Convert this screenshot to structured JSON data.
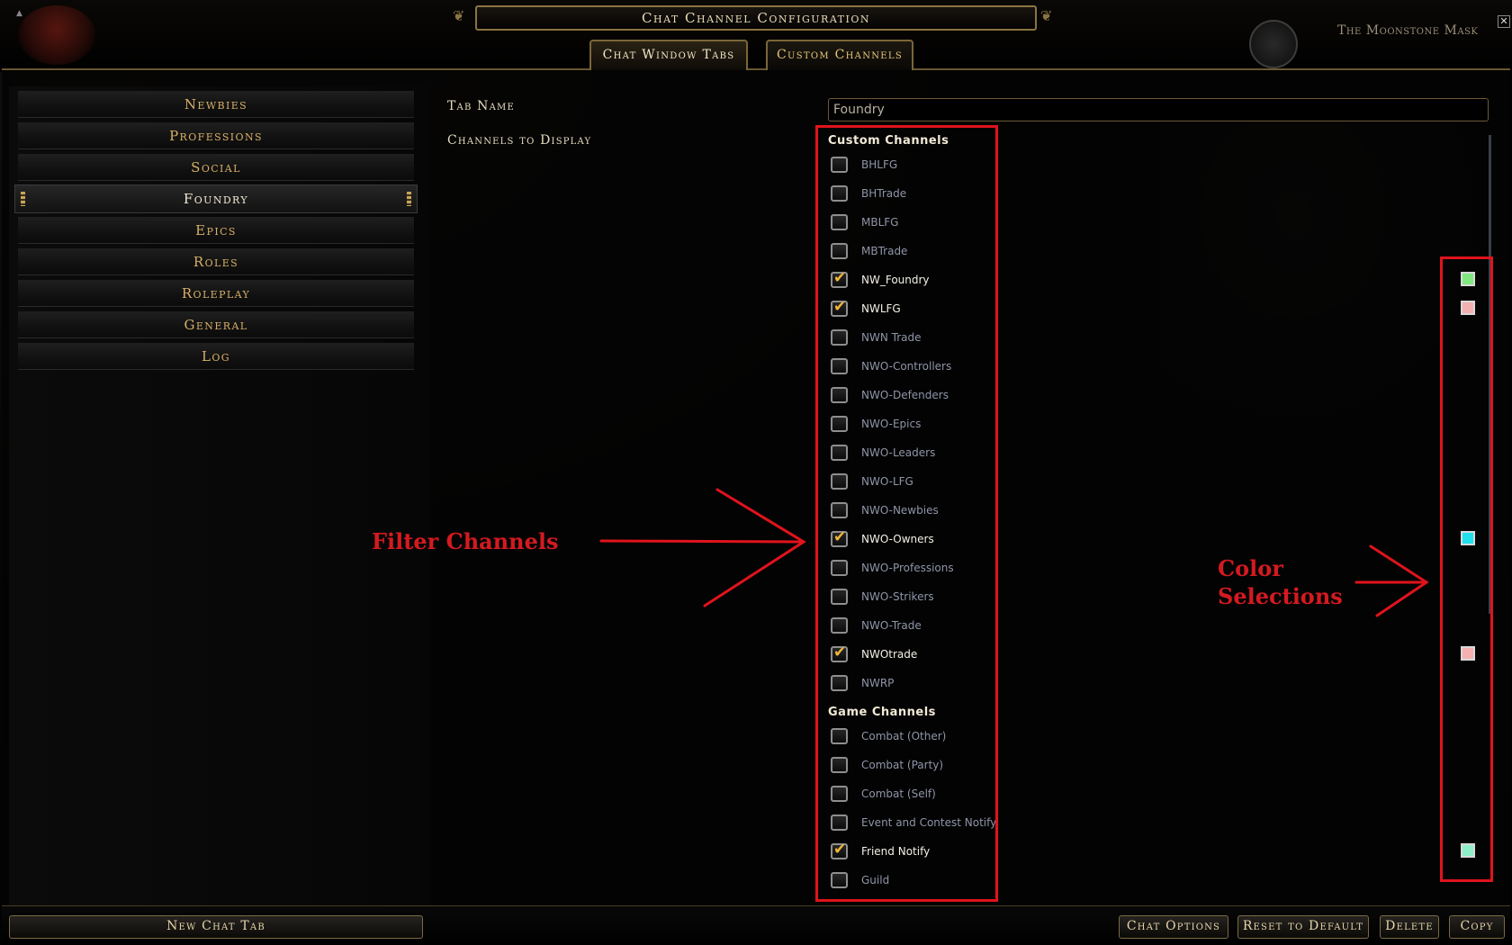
{
  "window": {
    "title": "Chat Channel Configuration",
    "zone_name": "The Moonstone Mask",
    "close_label": "✕",
    "scroll_up": "▲"
  },
  "tabs": [
    {
      "label": "Chat Window Tabs",
      "active": true
    },
    {
      "label": "Custom Channels",
      "active": false
    }
  ],
  "sidebar": {
    "items": [
      {
        "label": "Newbies"
      },
      {
        "label": "Professions"
      },
      {
        "label": "Social"
      },
      {
        "label": "Foundry",
        "selected": true
      },
      {
        "label": "Epics"
      },
      {
        "label": "Roles"
      },
      {
        "label": "Roleplay"
      },
      {
        "label": "General"
      },
      {
        "label": "Log"
      }
    ]
  },
  "form": {
    "tab_name_label": "Tab Name",
    "tab_name_value": "Foundry",
    "channels_label": "Channels to Display"
  },
  "channels": {
    "custom_heading": "Custom Channels",
    "custom": [
      {
        "name": "BHLFG",
        "checked": false
      },
      {
        "name": "BHTrade",
        "checked": false
      },
      {
        "name": "MBLFG",
        "checked": false
      },
      {
        "name": "MBTrade",
        "checked": false
      },
      {
        "name": "NW_Foundry",
        "checked": true,
        "color": "#7fe87f"
      },
      {
        "name": "NWLFG",
        "checked": true,
        "color": "#f4b0b0"
      },
      {
        "name": "NWN Trade",
        "checked": false
      },
      {
        "name": "NWO-Controllers",
        "checked": false
      },
      {
        "name": "NWO-Defenders",
        "checked": false
      },
      {
        "name": "NWO-Epics",
        "checked": false
      },
      {
        "name": "NWO-Leaders",
        "checked": false
      },
      {
        "name": "NWO-LFG",
        "checked": false
      },
      {
        "name": "NWO-Newbies",
        "checked": false
      },
      {
        "name": "NWO-Owners",
        "checked": true,
        "color": "#20e0ee"
      },
      {
        "name": "NWO-Professions",
        "checked": false
      },
      {
        "name": "NWO-Strikers",
        "checked": false
      },
      {
        "name": "NWO-Trade",
        "checked": false
      },
      {
        "name": "NWOtrade",
        "checked": true,
        "color": "#f6b0b0"
      },
      {
        "name": "NWRP",
        "checked": false
      }
    ],
    "game_heading": "Game Channels",
    "game": [
      {
        "name": "Combat (Other)",
        "checked": false
      },
      {
        "name": "Combat (Party)",
        "checked": false
      },
      {
        "name": "Combat (Self)",
        "checked": false
      },
      {
        "name": "Event and Contest Notify",
        "checked": false
      },
      {
        "name": "Friend Notify",
        "checked": true,
        "color": "#8ef0c8"
      },
      {
        "name": "Guild",
        "checked": false
      }
    ]
  },
  "annotations": {
    "filter_label": "Filter Channels",
    "color_label_line1": "Color",
    "color_label_line2": "Selections",
    "accent": "#e0131c"
  },
  "buttons": {
    "new_chat_tab": "New Chat Tab",
    "chat_options": "Chat Options",
    "reset_to_default": "Reset to Default",
    "delete": "Delete",
    "copy": "Copy"
  },
  "icons": {
    "checkbox_tick": "✔",
    "pip": "ornament-icon"
  }
}
